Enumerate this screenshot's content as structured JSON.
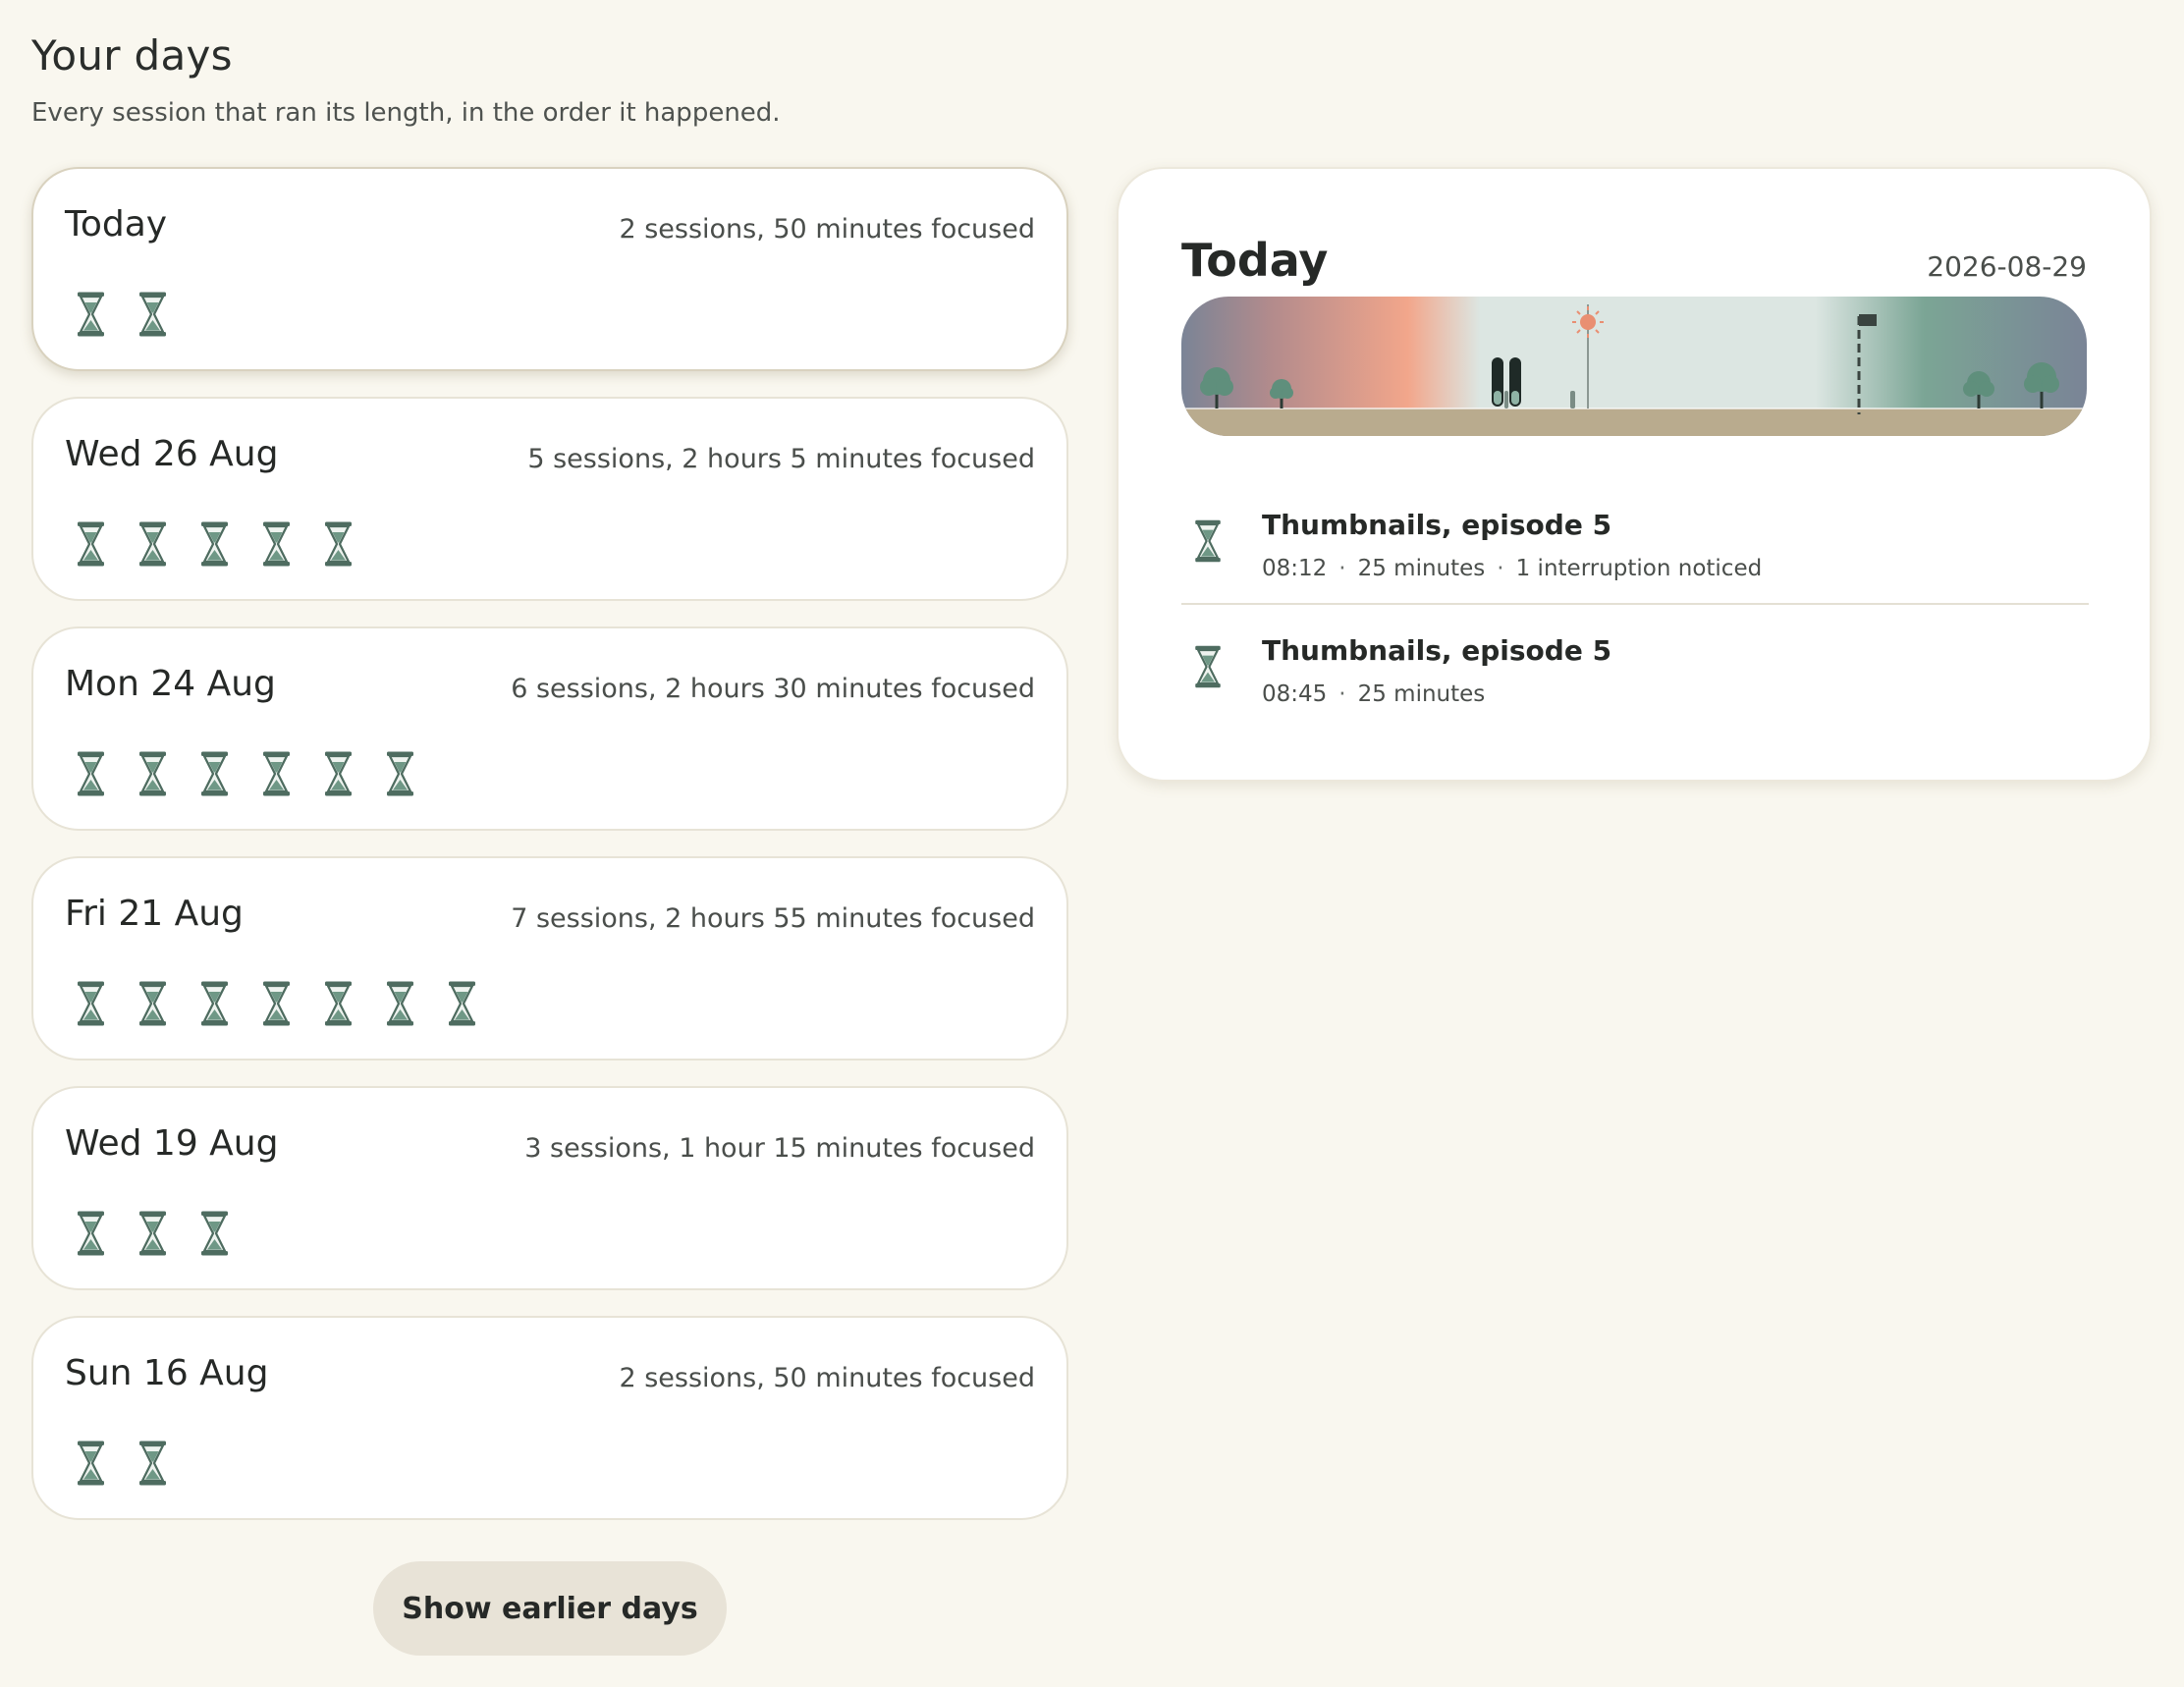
{
  "header": {
    "title": "Your days",
    "subtitle": "Every session that ran its length, in the order it happened."
  },
  "days": [
    {
      "name": "Today",
      "summary": "2 sessions, 50 minutes focused",
      "sessions": 2,
      "selected": true
    },
    {
      "name": "Wed 26 Aug",
      "summary": "5 sessions, 2 hours 5 minutes focused",
      "sessions": 5,
      "selected": false
    },
    {
      "name": "Mon 24 Aug",
      "summary": "6 sessions, 2 hours 30 minutes focused",
      "sessions": 6,
      "selected": false
    },
    {
      "name": "Fri 21 Aug",
      "summary": "7 sessions, 2 hours 55 minutes focused",
      "sessions": 7,
      "selected": false
    },
    {
      "name": "Wed 19 Aug",
      "summary": "3 sessions, 1 hour 15 minutes focused",
      "sessions": 3,
      "selected": false
    },
    {
      "name": "Sun 16 Aug",
      "summary": "2 sessions, 50 minutes focused",
      "sessions": 2,
      "selected": false
    }
  ],
  "show_earlier_label": "Show earlier days",
  "detail": {
    "title": "Today",
    "date": "2026-08-29",
    "sessions": [
      {
        "title": "Thumbnails, episode 5",
        "time": "08:12",
        "duration": "25 minutes",
        "note": "1 interruption noticed"
      },
      {
        "title": "Thumbnails, episode 5",
        "time": "08:45",
        "duration": "25 minutes",
        "note": ""
      }
    ]
  },
  "icons": {
    "session": "hourglass-icon",
    "sun": "sun-icon",
    "flag": "flag-icon",
    "tree": "tree-icon"
  },
  "colors": {
    "background": "#f9f7ef",
    "card": "#ffffff",
    "hourglass_fill": "#6f9886",
    "hourglass_frame": "#4e6c60",
    "ground": "#b9ab8e",
    "sunrise": "#f2a68b",
    "sky_day": "#dce6e2",
    "sky_night": "#7a8496",
    "button": "#e8e3d7"
  }
}
